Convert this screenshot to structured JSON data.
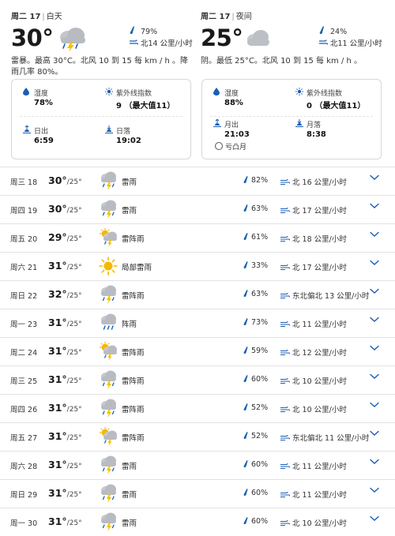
{
  "day": {
    "header_date": "周二 17",
    "header_period": "白天",
    "temp": "30°",
    "precip": "79%",
    "wind": "北14 公里/小时",
    "desc": "雷暴。最高 30°C。北风 10 到 15 每 km / h 。降雨几率 80%。",
    "humidity_label": "湿度",
    "humidity": "78%",
    "uv_label": "紫外线指数",
    "uv": "9 （最大值11）",
    "sunrise_label": "日出",
    "sunrise": "6:59",
    "sunset_label": "日落",
    "sunset": "19:02"
  },
  "night": {
    "header_date": "周二 17",
    "header_period": "夜间",
    "temp": "25°",
    "precip": "24%",
    "wind": "北11 公里/小时",
    "desc": "阴。最低 25°C。北风 10 到 15 每 km / h 。",
    "humidity_label": "湿度",
    "humidity": "88%",
    "uv_label": "紫外线指数",
    "uv": "0 （最大值11）",
    "moonrise_label": "月出",
    "moonrise": "21:03",
    "moonset_label": "月落",
    "moonset": "8:38",
    "moon_phase": "亏凸月"
  },
  "forecast": [
    {
      "day": "周三 18",
      "hi": "30°",
      "lo": "/25°",
      "icon": "thunder-rain",
      "cond": "雷雨",
      "rain": "82%",
      "wind": "北 16 公里/小时"
    },
    {
      "day": "周四 19",
      "hi": "30°",
      "lo": "/25°",
      "icon": "thunder-rain",
      "cond": "雷雨",
      "rain": "63%",
      "wind": "北 17 公里/小时"
    },
    {
      "day": "周五 20",
      "hi": "29°",
      "lo": "/25°",
      "icon": "sun-thunder",
      "cond": "雷阵雨",
      "rain": "61%",
      "wind": "北 18 公里/小时"
    },
    {
      "day": "周六 21",
      "hi": "31°",
      "lo": "/25°",
      "icon": "sun",
      "cond": "局部雷雨",
      "rain": "33%",
      "wind": "北 17 公里/小时"
    },
    {
      "day": "周日 22",
      "hi": "32°",
      "lo": "/25°",
      "icon": "thunder-rain",
      "cond": "雷阵雨",
      "rain": "63%",
      "wind": "东北偏北 13 公里/小时"
    },
    {
      "day": "周一 23",
      "hi": "31°",
      "lo": "/25°",
      "icon": "rain",
      "cond": "阵雨",
      "rain": "73%",
      "wind": "北 11 公里/小时"
    },
    {
      "day": "周二 24",
      "hi": "31°",
      "lo": "/25°",
      "icon": "sun-thunder",
      "cond": "雷阵雨",
      "rain": "59%",
      "wind": "北 12 公里/小时"
    },
    {
      "day": "周三 25",
      "hi": "31°",
      "lo": "/25°",
      "icon": "thunder-rain",
      "cond": "雷阵雨",
      "rain": "60%",
      "wind": "北 10 公里/小时"
    },
    {
      "day": "周四 26",
      "hi": "31°",
      "lo": "/25°",
      "icon": "thunder-rain",
      "cond": "雷阵雨",
      "rain": "52%",
      "wind": "北 10 公里/小时"
    },
    {
      "day": "周五 27",
      "hi": "31°",
      "lo": "/25°",
      "icon": "sun-thunder",
      "cond": "雷阵雨",
      "rain": "52%",
      "wind": "东北偏北 11 公里/小时"
    },
    {
      "day": "周六 28",
      "hi": "31°",
      "lo": "/25°",
      "icon": "thunder-rain",
      "cond": "雷雨",
      "rain": "60%",
      "wind": "北 11 公里/小时"
    },
    {
      "day": "周日 29",
      "hi": "31°",
      "lo": "/25°",
      "icon": "thunder-rain",
      "cond": "雷雨",
      "rain": "60%",
      "wind": "北 11 公里/小时"
    },
    {
      "day": "周一 30",
      "hi": "31°",
      "lo": "/25°",
      "icon": "thunder-rain",
      "cond": "雷雨",
      "rain": "60%",
      "wind": "北 10 公里/小时"
    }
  ],
  "colors": {
    "accent": "#1a5fb4",
    "icon_gray": "#b8bcc2",
    "sun": "#f5b800",
    "bolt": "#f2c200",
    "divider": "#e2e2e2"
  }
}
